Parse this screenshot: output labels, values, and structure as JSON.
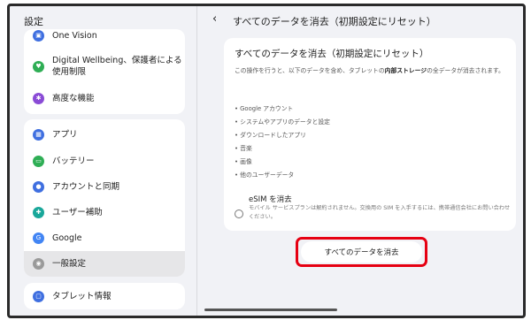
{
  "sidebar": {
    "title": "設定",
    "items": [
      {
        "label": "One Vision",
        "icon": "one-vision-icon",
        "color": "#3f6fe0"
      },
      {
        "label": "Digital Wellbeing、保護者による",
        "label2": "使用制限",
        "icon": "digital-wellbeing-icon",
        "color": "#2fae55"
      },
      {
        "label": "高度な機能",
        "icon": "advanced-features-icon",
        "color": "#8a4bd6"
      },
      {
        "label": "アプリ",
        "icon": "apps-icon",
        "color": "#3f6fe0"
      },
      {
        "label": "バッテリー",
        "icon": "battery-icon",
        "color": "#2fae55"
      },
      {
        "label": "アカウントと同期",
        "icon": "account-icon",
        "color": "#3f6fe0"
      },
      {
        "label": "ユーザー補助",
        "icon": "accessibility-icon",
        "color": "#19a79a"
      },
      {
        "label": "Google",
        "icon": "google-icon",
        "color": "#4285f4"
      },
      {
        "label": "一般設定",
        "icon": "general-settings-icon",
        "color": "#9a9a9a"
      },
      {
        "label": "タブレット情報",
        "icon": "tablet-info-icon",
        "color": "#3f6fe0"
      }
    ]
  },
  "header": {
    "title": "すべてのデータを消去（初期設定にリセット）"
  },
  "content": {
    "title": "すべてのデータを消去（初期設定にリセット）",
    "desc_pre": "この操作を行うと、以下のデータを含め、タブレットの",
    "desc_bold": "内部ストレージ",
    "desc_post": "の全データが消去されます。",
    "bullets": [
      "• Google アカウント",
      "• システムやアプリのデータと設定",
      "• ダウンロードしたアプリ",
      "• 音楽",
      "• 画像",
      "• 他のユーザーデータ"
    ],
    "esim_title": "eSIM を消去",
    "esim_desc": "モバイル サービスプランは解約されません。交換用の SIM を入手するには、携帯通信会社にお問い合わせください。",
    "erase_button": "すべてのデータを消去"
  },
  "colors": {
    "highlight": "#e60012",
    "background": "#f1f2f6"
  }
}
